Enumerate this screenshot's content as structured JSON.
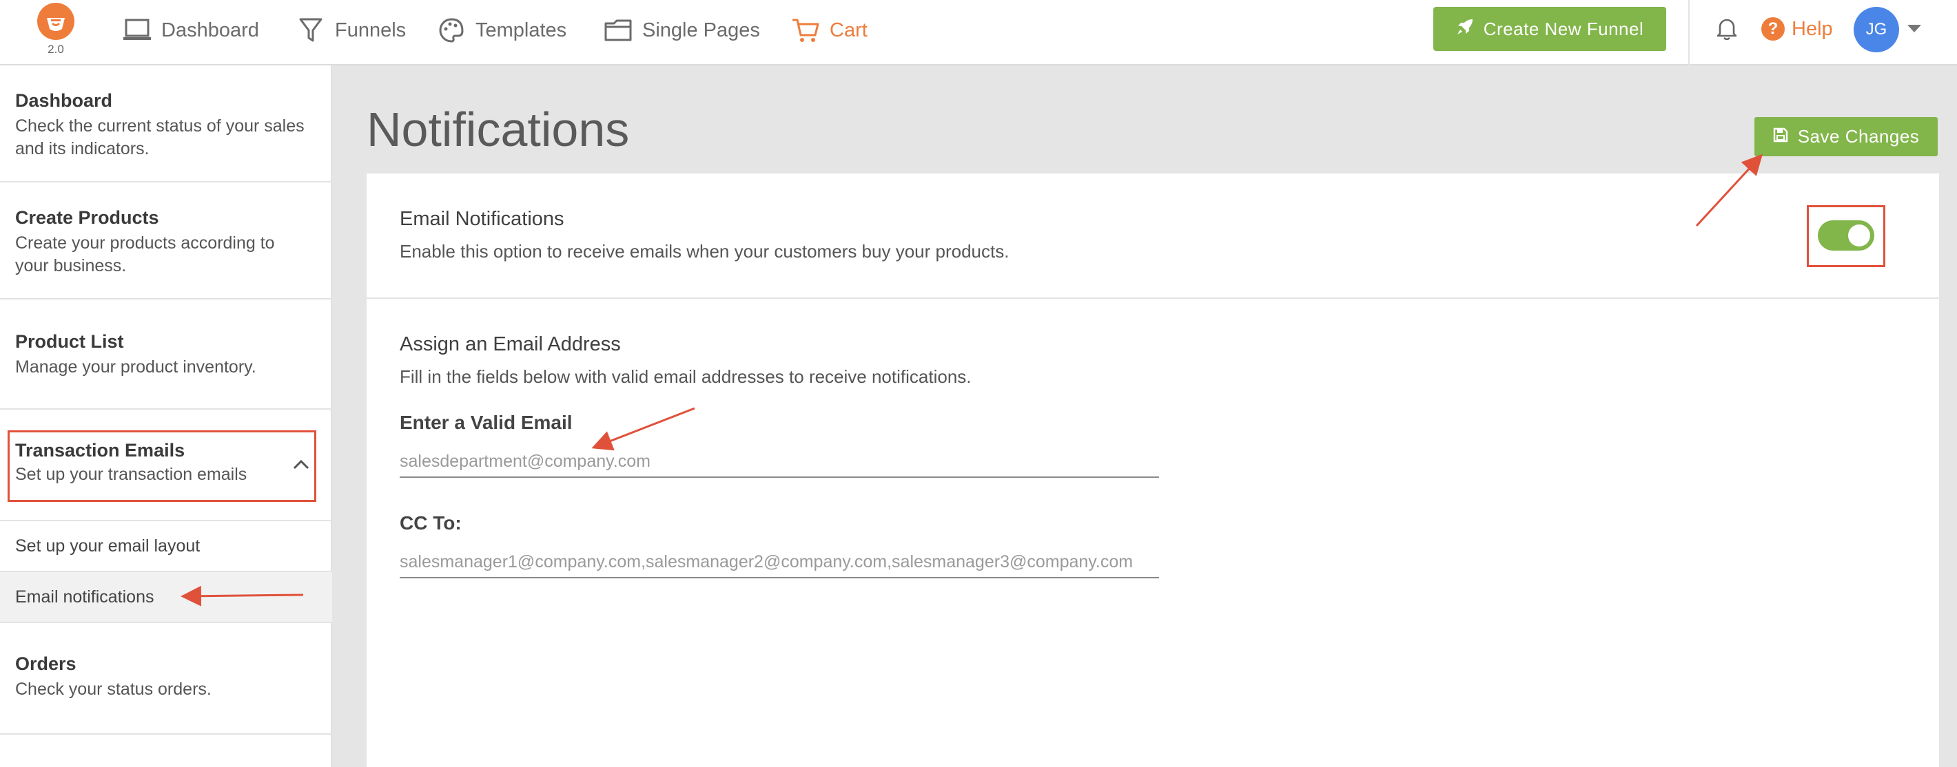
{
  "app": {
    "logo_version": "2.0"
  },
  "nav": {
    "items": [
      {
        "label": "Dashboard",
        "icon": "laptop-icon"
      },
      {
        "label": "Funnels",
        "icon": "funnel-icon"
      },
      {
        "label": "Templates",
        "icon": "palette-icon"
      },
      {
        "label": "Single Pages",
        "icon": "folder-icon"
      },
      {
        "label": "Cart",
        "icon": "cart-icon",
        "active": true
      }
    ],
    "create_funnel_label": "Create New Funnel",
    "help_label": "Help",
    "avatar_initials": "JG"
  },
  "sidebar": {
    "sections": [
      {
        "title": "Dashboard",
        "desc": "Check the current status of your sales and its indicators."
      },
      {
        "title": "Create Products",
        "desc": "Create your products according to your business."
      },
      {
        "title": "Product List",
        "desc": "Manage your product inventory."
      },
      {
        "title": "Transaction Emails",
        "desc": "Set up your transaction emails",
        "expanded": true
      },
      {
        "title": "Orders",
        "desc": "Check your status orders."
      }
    ],
    "sub_items": [
      {
        "label": "Set up your email layout"
      },
      {
        "label": "Email notifications",
        "active": true
      }
    ]
  },
  "main": {
    "title": "Notifications",
    "save_label": "Save Changes",
    "email_notifications": {
      "title": "Email Notifications",
      "desc": "Enable this option to receive emails when your customers buy your products.",
      "enabled": true
    },
    "assign": {
      "title": "Assign an Email Address",
      "desc": "Fill in the fields below with valid email addresses to receive notifications.",
      "email_label": "Enter a Valid Email",
      "email_placeholder": "salesdepartment@company.com",
      "email_value": "",
      "cc_label": "CC To:",
      "cc_placeholder": "salesmanager1@company.com,salesmanager2@company.com,salesmanager3@company.com",
      "cc_value": ""
    }
  },
  "colors": {
    "brand_orange": "#ee7d3c",
    "accent_green": "#82b54a",
    "annotation_red": "#e0513a",
    "avatar_blue": "#4a86e8"
  }
}
